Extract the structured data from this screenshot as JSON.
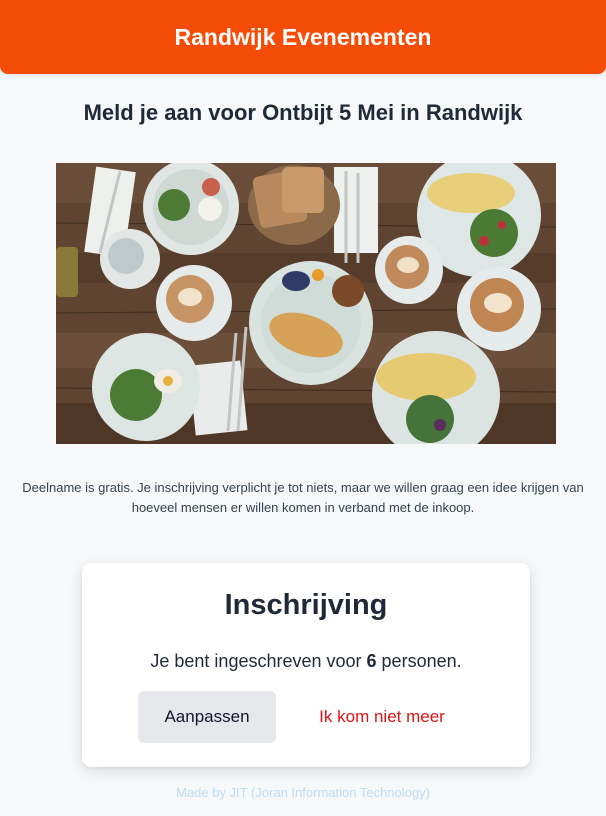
{
  "header": {
    "title": "Randwijk Evenementen"
  },
  "page": {
    "title": "Meld je aan voor Ontbijt 5 Mei in Randwijk"
  },
  "hero_image": {
    "alt": "Ontbijt"
  },
  "intro": {
    "text": "Deelname is gratis. Je inschrijving verplicht je tot niets, maar we willen graag een idee krijgen van hoeveel mensen er willen komen in verband met de inkoop."
  },
  "registration": {
    "title": "Inschrijving",
    "status_prefix": "Je bent ingeschreven voor ",
    "count": "6",
    "status_suffix": " personen.",
    "edit_label": "Aanpassen",
    "cancel_label": "Ik kom niet meer"
  },
  "footer": {
    "text": "Made by JIT (Joran Information Technology)"
  },
  "colors": {
    "brand": "#f54c07",
    "danger": "#dc1414",
    "footer": "#bcdcf4"
  }
}
